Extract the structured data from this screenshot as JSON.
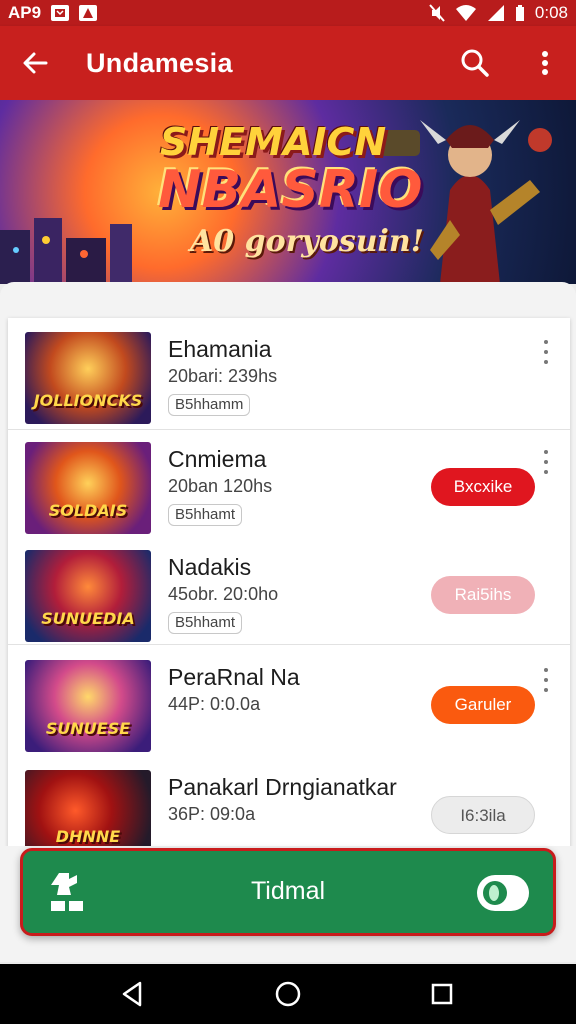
{
  "status_bar": {
    "left_text": "AP9",
    "time": "0:08",
    "icons": [
      "notification-icon",
      "alert-icon",
      "mute-icon",
      "wifi-icon",
      "signal-icon",
      "battery-icon"
    ]
  },
  "app_bar": {
    "title": "Undamesia",
    "icons": [
      "back-arrow-icon",
      "search-icon",
      "more-vert-icon"
    ]
  },
  "banner": {
    "title_line1": "SHEMAICN",
    "title_line2": "NBASRIO",
    "subtitle": "A0 goryosuin!"
  },
  "list": {
    "items": [
      {
        "thumb_text": "JOLLIONCKS",
        "name": "Ehamania",
        "meta": "20bari: 239hs",
        "tag": "B5hhamm",
        "button": null
      },
      {
        "thumb_text": "SOLDAIS",
        "name": "Cnmiema",
        "meta": "20ban 120hs",
        "tag": "B5hhamt",
        "button": {
          "label": "Bxcxike",
          "style": "primary-red"
        }
      },
      {
        "thumb_text": "SUNUEDIA",
        "name": "Nadakis",
        "meta": "45obr. 20:0ho",
        "tag": "B5hhamt",
        "button": {
          "label": "Rai5ihs",
          "style": "disabled-pink"
        }
      },
      {
        "thumb_text": "SUNUESE",
        "name": "PeraRnal Na",
        "meta": "44P: 0:0.0a",
        "tag": null,
        "button": {
          "label": "Garuler",
          "style": "orange"
        }
      },
      {
        "thumb_text": "DHNNE",
        "name": "Panakarl Drngianatkar",
        "meta": "36P: 09:0a",
        "tag": null,
        "button": {
          "label": "I6:3ila",
          "style": "disabled-grey"
        }
      }
    ]
  },
  "bottom_action": {
    "label": "Tidmal",
    "toggle_on": true
  },
  "nav_bar": {
    "icons": [
      "back-triangle-icon",
      "home-circle-icon",
      "recents-square-icon"
    ]
  },
  "colors": {
    "app_bar": "#c8201e",
    "action_green": "#1e8a4d",
    "btn_red": "#e0161f",
    "btn_pink": "#f0b1b7",
    "btn_orange": "#fa5a0f",
    "btn_grey": "#ececec"
  }
}
